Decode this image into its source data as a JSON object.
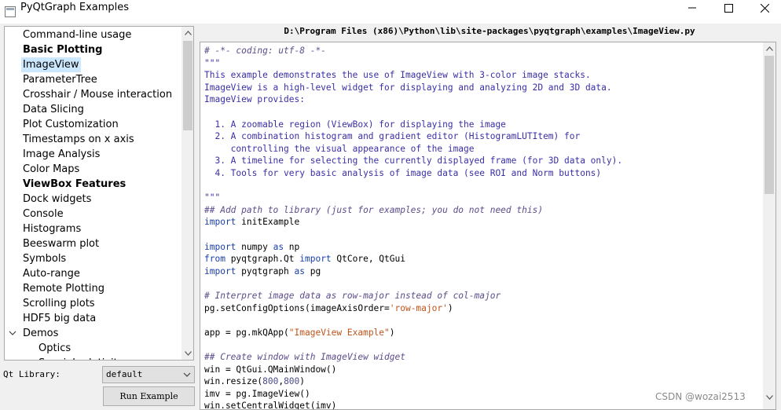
{
  "window": {
    "title": "PyQtGraph Examples",
    "icons": [
      "app-icon",
      "minimize-icon",
      "maximize-icon",
      "close-icon"
    ]
  },
  "tree": {
    "items": [
      {
        "label": "Command-line usage",
        "bold": false,
        "selected": false,
        "indent": 0
      },
      {
        "label": "Basic Plotting",
        "bold": true,
        "selected": false,
        "indent": 0
      },
      {
        "label": "ImageView",
        "bold": false,
        "selected": true,
        "indent": 0
      },
      {
        "label": "ParameterTree",
        "bold": false,
        "selected": false,
        "indent": 0
      },
      {
        "label": "Crosshair / Mouse interaction",
        "bold": false,
        "selected": false,
        "indent": 0
      },
      {
        "label": "Data Slicing",
        "bold": false,
        "selected": false,
        "indent": 0
      },
      {
        "label": "Plot Customization",
        "bold": false,
        "selected": false,
        "indent": 0
      },
      {
        "label": "Timestamps on x axis",
        "bold": false,
        "selected": false,
        "indent": 0
      },
      {
        "label": "Image Analysis",
        "bold": false,
        "selected": false,
        "indent": 0
      },
      {
        "label": "Color Maps",
        "bold": false,
        "selected": false,
        "indent": 0
      },
      {
        "label": "ViewBox Features",
        "bold": true,
        "selected": false,
        "indent": 0
      },
      {
        "label": "Dock widgets",
        "bold": false,
        "selected": false,
        "indent": 0
      },
      {
        "label": "Console",
        "bold": false,
        "selected": false,
        "indent": 0
      },
      {
        "label": "Histograms",
        "bold": false,
        "selected": false,
        "indent": 0
      },
      {
        "label": "Beeswarm plot",
        "bold": false,
        "selected": false,
        "indent": 0
      },
      {
        "label": "Symbols",
        "bold": false,
        "selected": false,
        "indent": 0
      },
      {
        "label": "Auto-range",
        "bold": false,
        "selected": false,
        "indent": 0
      },
      {
        "label": "Remote Plotting",
        "bold": false,
        "selected": false,
        "indent": 0
      },
      {
        "label": "Scrolling plots",
        "bold": false,
        "selected": false,
        "indent": 0
      },
      {
        "label": "HDF5 big data",
        "bold": false,
        "selected": false,
        "indent": 0
      },
      {
        "label": "Demos",
        "bold": false,
        "selected": false,
        "indent": 0,
        "expanded": true
      },
      {
        "label": "Optics",
        "bold": false,
        "selected": false,
        "indent": 1
      },
      {
        "label": "Special relativity",
        "bold": false,
        "selected": false,
        "indent": 1
      }
    ],
    "selected_bg": "#cce8ff"
  },
  "controls": {
    "qt_library_label": "Qt Library:",
    "qt_library_value": "default",
    "run_button_label": "Run Example"
  },
  "code": {
    "file_path": "D:\\Program Files (x86)\\Python\\lib\\site-packages\\pyqtgraph\\examples\\ImageView.py",
    "lines": [
      [
        {
          "t": "# -*- coding: utf-8 -*-",
          "c": "comment"
        }
      ],
      [
        {
          "t": "\"\"\"",
          "c": "doc"
        }
      ],
      [
        {
          "t": "This example demonstrates the use of ImageView with 3-color image stacks.",
          "c": "doc"
        }
      ],
      [
        {
          "t": "ImageView is a high-level widget for displaying and analyzing 2D and 3D data.",
          "c": "doc"
        }
      ],
      [
        {
          "t": "ImageView provides:",
          "c": "doc"
        }
      ],
      [
        {
          "t": "",
          "c": "doc"
        }
      ],
      [
        {
          "t": "  1. A zoomable region (ViewBox) for displaying the image",
          "c": "doc"
        }
      ],
      [
        {
          "t": "  2. A combination histogram and gradient editor (HistogramLUTItem) for",
          "c": "doc"
        }
      ],
      [
        {
          "t": "     controlling the visual appearance of the image",
          "c": "doc"
        }
      ],
      [
        {
          "t": "  3. A timeline for selecting the currently displayed frame (for 3D data only).",
          "c": "doc"
        }
      ],
      [
        {
          "t": "  4. Tools for very basic analysis of image data (see ROI and Norm buttons)",
          "c": "doc"
        }
      ],
      [
        {
          "t": "",
          "c": "doc"
        }
      ],
      [
        {
          "t": "\"\"\"",
          "c": "doc"
        }
      ],
      [
        {
          "t": "## Add path to library (just for examples; you do not need this)",
          "c": "comment"
        }
      ],
      [
        {
          "t": "import",
          "c": "kw"
        },
        {
          "t": " initExample",
          "c": ""
        }
      ],
      [
        {
          "t": "",
          "c": ""
        }
      ],
      [
        {
          "t": "import",
          "c": "kw"
        },
        {
          "t": " numpy ",
          "c": ""
        },
        {
          "t": "as",
          "c": "kw"
        },
        {
          "t": " np",
          "c": ""
        }
      ],
      [
        {
          "t": "from",
          "c": "kw"
        },
        {
          "t": " pyqtgraph.Qt ",
          "c": ""
        },
        {
          "t": "import",
          "c": "kw"
        },
        {
          "t": " QtCore, QtGui",
          "c": ""
        }
      ],
      [
        {
          "t": "import",
          "c": "kw"
        },
        {
          "t": " pyqtgraph ",
          "c": ""
        },
        {
          "t": "as",
          "c": "kw"
        },
        {
          "t": " pg",
          "c": ""
        }
      ],
      [
        {
          "t": "",
          "c": ""
        }
      ],
      [
        {
          "t": "# Interpret image data as row-major instead of col-major",
          "c": "comment"
        }
      ],
      [
        {
          "t": "pg.setConfigOptions(imageAxisOrder=",
          "c": ""
        },
        {
          "t": "'row-major'",
          "c": "str"
        },
        {
          "t": ")",
          "c": ""
        }
      ],
      [
        {
          "t": "",
          "c": ""
        }
      ],
      [
        {
          "t": "app = pg.mkQApp(",
          "c": ""
        },
        {
          "t": "\"ImageView Example\"",
          "c": "str"
        },
        {
          "t": ")",
          "c": ""
        }
      ],
      [
        {
          "t": "",
          "c": ""
        }
      ],
      [
        {
          "t": "## Create window with ImageView widget",
          "c": "comment"
        }
      ],
      [
        {
          "t": "win = QtGui.QMainWindow()",
          "c": ""
        }
      ],
      [
        {
          "t": "win.resize(",
          "c": ""
        },
        {
          "t": "800",
          "c": "num"
        },
        {
          "t": ",",
          "c": ""
        },
        {
          "t": "800",
          "c": "num"
        },
        {
          "t": ")",
          "c": ""
        }
      ],
      [
        {
          "t": "imv = pg.ImageView()",
          "c": ""
        }
      ],
      [
        {
          "t": "win.setCentralWidget(imv)",
          "c": ""
        }
      ]
    ]
  },
  "watermark": "CSDN @wozai2513"
}
